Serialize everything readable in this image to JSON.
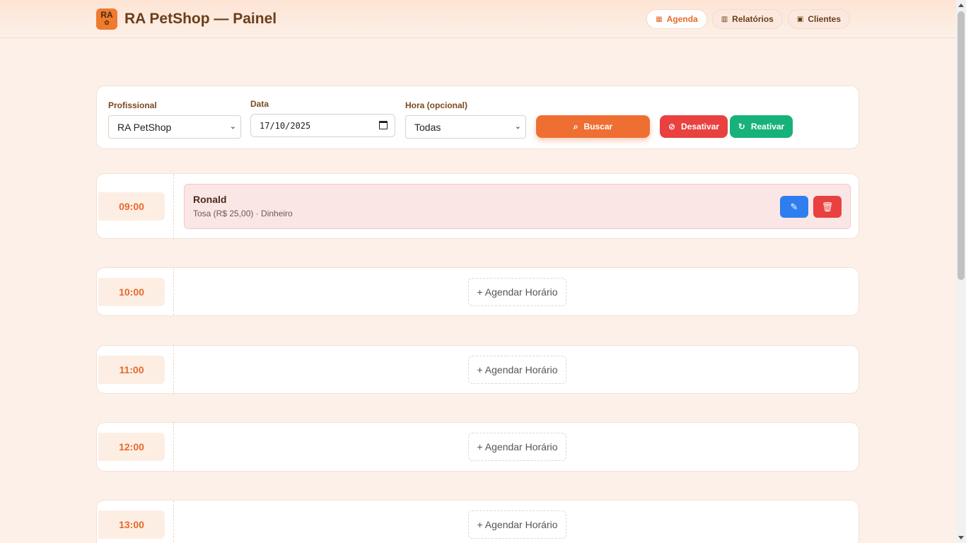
{
  "header": {
    "logo_text": "RA",
    "title": "RA PetShop — Painel",
    "nav": [
      {
        "label": "Agenda",
        "icon": "calendar-icon",
        "active": true
      },
      {
        "label": "Relatórios",
        "icon": "bar-chart-icon",
        "active": false
      },
      {
        "label": "Clientes",
        "icon": "contacts-icon",
        "active": false
      }
    ]
  },
  "filters": {
    "professional_label": "Profissional",
    "professional_value": "RA PetShop",
    "date_label": "Data",
    "date_value": "17/10/2025",
    "hour_label": "Hora (opcional)",
    "hour_value": "Todas",
    "search_label": "Buscar",
    "deactivate_label": "Desativar",
    "reactivate_label": "Reativar"
  },
  "slots": [
    {
      "time": "09:00",
      "appointment": {
        "client": "Ronald",
        "detail": "Tosa (R$ 25,00) · Dinheiro"
      }
    },
    {
      "time": "10:00",
      "add_label": "+ Agendar Horário"
    },
    {
      "time": "11:00",
      "add_label": "+ Agendar Horário"
    },
    {
      "time": "12:00",
      "add_label": "+ Agendar Horário"
    },
    {
      "time": "13:00",
      "add_label": "+ Agendar Horário"
    }
  ],
  "colors": {
    "accent": "#e8692a",
    "background": "#fdf0e8",
    "danger": "#e8413f",
    "success": "#16b27a",
    "edit": "#2f7ef0"
  }
}
